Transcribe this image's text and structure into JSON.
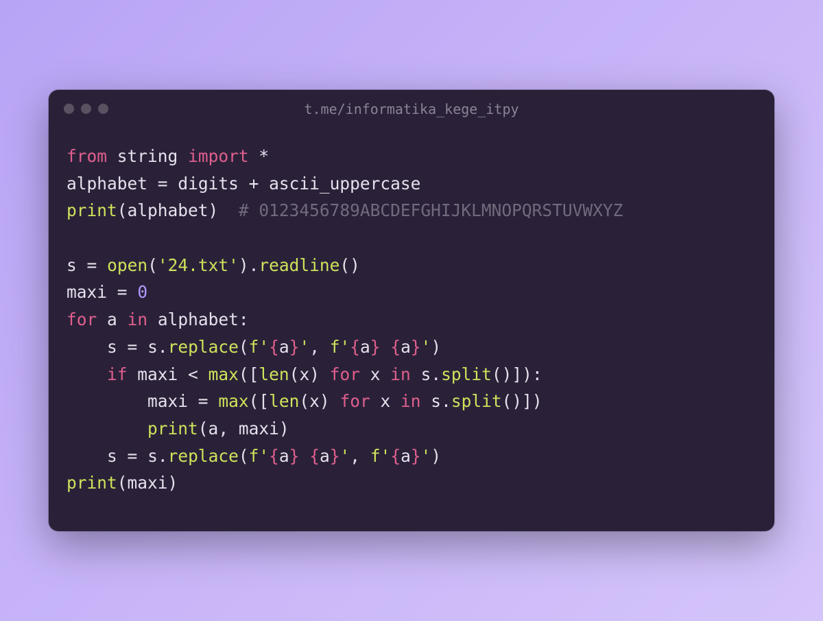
{
  "title": "t.me/informatika_kege_itpy",
  "code": {
    "l1": {
      "from": "from",
      "mod": "string",
      "imp": "import",
      "star": "*"
    },
    "l2": {
      "v": "alphabet",
      "eq": "=",
      "d": "digits",
      "plus": "+",
      "au": "ascii_uppercase"
    },
    "l3": {
      "fn": "print",
      "lp": "(",
      "arg": "alphabet",
      "rp": ")",
      "sp": "  ",
      "cmt": "# 0123456789ABCDEFGHIJKLMNOPQRSTUVWXYZ"
    },
    "l5": {
      "v": "s",
      "eq": "=",
      "fn": "open",
      "lp": "(",
      "str": "'24.txt'",
      "rp": ")",
      "dot": ".",
      "m": "readline",
      "lp2": "(",
      "rp2": ")"
    },
    "l6": {
      "v": "maxi",
      "eq": "=",
      "num": "0"
    },
    "l7": {
      "for": "for",
      "a": "a",
      "in": "in",
      "it": "alphabet",
      "col": ":"
    },
    "l8": {
      "ind": "    ",
      "v": "s",
      "eq": "=",
      "s": "s",
      "dot": ".",
      "m": "replace",
      "lp": "(",
      "f1a": "f'",
      "b1o": "{",
      "a1": "a",
      "b1c": "}",
      "f1b": "'",
      "cm": ",",
      "sp": " ",
      "f2a": "f'",
      "b2o": "{",
      "a2": "a",
      "b2c": "}",
      "spc": " ",
      "b3o": "{",
      "a3": "a",
      "b3c": "}",
      "f2b": "'",
      "rp": ")"
    },
    "l9": {
      "ind": "    ",
      "if": "if",
      "mx": "maxi",
      "lt": "<",
      "fn": "max",
      "lp": "(",
      "lb": "[",
      "len": "len",
      "lp2": "(",
      "x": "x",
      "rp2": ")",
      "for": "for",
      "x2": "x",
      "in": "in",
      "s": "s",
      "dot": ".",
      "sp": "split",
      "lp3": "(",
      "rp3": ")",
      "rb": "]",
      "rp": ")",
      "col": ":"
    },
    "l10": {
      "ind": "        ",
      "v": "maxi",
      "eq": "=",
      "fn": "max",
      "lp": "(",
      "lb": "[",
      "len": "len",
      "lp2": "(",
      "x": "x",
      "rp2": ")",
      "for": "for",
      "x2": "x",
      "in": "in",
      "s": "s",
      "dot": ".",
      "sp": "split",
      "lp3": "(",
      "rp3": ")",
      "rb": "]",
      "rp": ")"
    },
    "l11": {
      "ind": "        ",
      "fn": "print",
      "lp": "(",
      "a": "a",
      "cm": ",",
      "sp": " ",
      "mx": "maxi",
      "rp": ")"
    },
    "l12": {
      "ind": "    ",
      "v": "s",
      "eq": "=",
      "s": "s",
      "dot": ".",
      "m": "replace",
      "lp": "(",
      "f1a": "f'",
      "b1o": "{",
      "a1": "a",
      "b1c": "}",
      "spc": " ",
      "b2o": "{",
      "a2": "a",
      "b2c": "}",
      "f1b": "'",
      "cm": ",",
      "sp": " ",
      "f2a": "f'",
      "b3o": "{",
      "a3": "a",
      "b3c": "}",
      "f2b": "'",
      "rp": ")"
    },
    "l13": {
      "fn": "print",
      "lp": "(",
      "arg": "maxi",
      "rp": ")"
    }
  }
}
